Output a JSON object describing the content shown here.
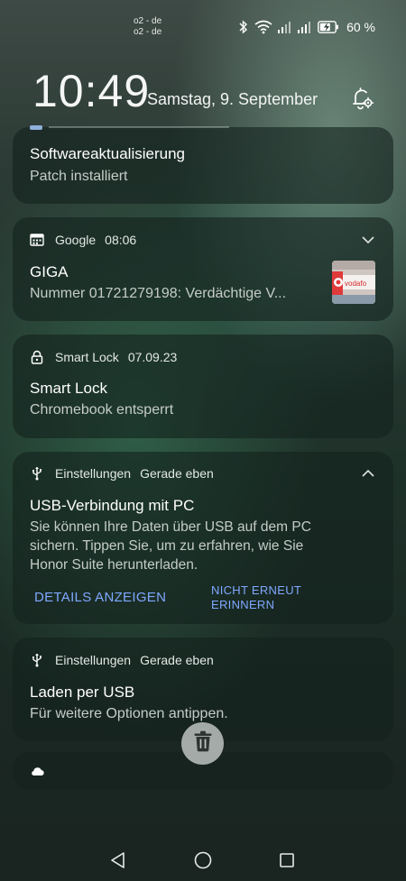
{
  "status_bar": {
    "carrier_line1": "o2 - de",
    "carrier_line2": "o2 - de",
    "battery_percent": "60 %",
    "icons": [
      "bluetooth-icon",
      "wifi-icon",
      "signal-icon",
      "signal-icon",
      "battery-charging-icon"
    ]
  },
  "lockscreen": {
    "time": "10:49",
    "date": "Samstag, 9. September"
  },
  "notifications": [
    {
      "icon": "app-icon",
      "title": "Softwareaktualisierung",
      "text": "Patch installiert"
    },
    {
      "icon": "calendar-icon",
      "app": "Google",
      "time": "08:06",
      "title": "GIGA",
      "text": "Nummer 01721279198: Verdächtige V..."
    },
    {
      "icon": "lock-icon",
      "app": "Smart Lock",
      "time": "07.09.23",
      "title": "Smart Lock",
      "text": "Chromebook entsperrt"
    },
    {
      "icon": "usb-icon",
      "app": "Einstellungen",
      "time": "Gerade eben",
      "title": "USB-Verbindung mit PC",
      "text_lines": [
        "Sie können Ihre Daten über USB auf dem PC",
        "sichern. Tippen Sie, um zu erfahren, wie Sie",
        "Honor Suite herunterladen."
      ],
      "actions": {
        "primary": "DETAILS ANZEIGEN",
        "secondary_line1": "NICHT ERNEUT",
        "secondary_line2": "ERINNERN"
      }
    },
    {
      "icon": "usb-icon",
      "app": "Einstellungen",
      "time": "Gerade eben",
      "title": "Laden per USB",
      "text": "Für weitere Optionen antippen."
    },
    {
      "icon": "cloud-icon"
    }
  ],
  "colors": {
    "accent": "#7fa8ff",
    "card_bg": "#14221d"
  }
}
